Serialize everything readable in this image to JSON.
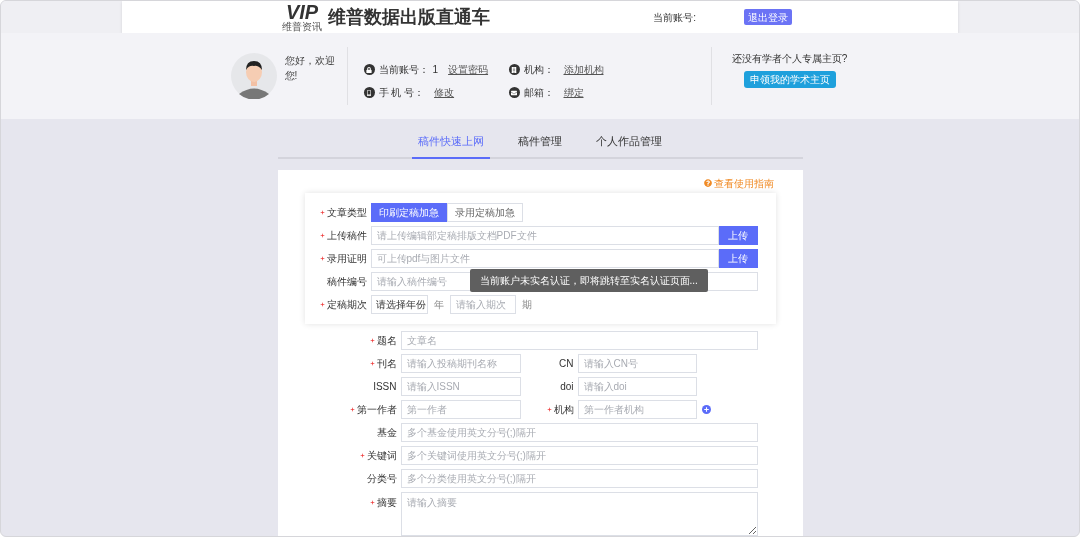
{
  "header": {
    "logo": {
      "mark": "VIP",
      "caption": "维普资讯"
    },
    "title": "维普数据出版直通车",
    "account_label": "当前账号:",
    "logout_button": "退出登录"
  },
  "profile": {
    "greeting": "您好，欢迎您!",
    "info": [
      {
        "kind": "lock",
        "label": "当前账号：",
        "value": "1",
        "link": "设置密码"
      },
      {
        "kind": "building",
        "label": "机构：",
        "link": "添加机构"
      },
      {
        "kind": "phone",
        "label": "手 机 号：",
        "link": "修改"
      },
      {
        "kind": "mail",
        "label": "邮箱：",
        "link": "绑定"
      }
    ],
    "promo_text": "还没有学者个人专属主页?",
    "promo_button": "申领我的学术主页"
  },
  "tabs": [
    {
      "label": "稿件快速上网",
      "selected": true
    },
    {
      "label": "稿件管理",
      "selected": false
    },
    {
      "label": "个人作品管理",
      "selected": false
    }
  ],
  "guide_link": "查看使用指南",
  "upload_form": [
    {
      "kind": "segmented",
      "label": "文章类型",
      "required": true,
      "options": [
        {
          "label": "印刷定稿加急",
          "selected": true
        },
        {
          "label": "录用定稿加急",
          "selected": false
        }
      ]
    },
    {
      "kind": "upload",
      "label": "上传稿件",
      "required": true,
      "placeholder": "请上传编辑部定稿排版文档PDF文件",
      "button": "上传"
    },
    {
      "kind": "upload",
      "label": "录用证明",
      "required": true,
      "placeholder": "可上传pdf与图片文件",
      "button": "上传"
    },
    {
      "kind": "text",
      "label": "稿件编号",
      "required": false,
      "placeholder": "请输入稿件编号"
    },
    {
      "kind": "period",
      "label": "定稿期次",
      "required": true,
      "select_placeholder": "请选择年份",
      "year_unit": "年",
      "placeholder": "请输入期次",
      "period_unit": "期"
    }
  ],
  "toast": "当前账户未实名认证，即将跳转至实名认证页面...",
  "details_form": [
    {
      "kind": "text",
      "label": "题名",
      "required": true,
      "placeholder": "文章名"
    },
    {
      "kind": "pair",
      "fields": [
        {
          "label": "刊名",
          "required": true,
          "placeholder": "请输入投稿期刊名称"
        },
        {
          "label": "CN",
          "required": false,
          "placeholder": "请输入CN号"
        }
      ],
      "add_button": false
    },
    {
      "kind": "pair",
      "fields": [
        {
          "label": "ISSN",
          "required": false,
          "placeholder": "请输入ISSN"
        },
        {
          "label": "doi",
          "required": false,
          "placeholder": "请输入doi"
        }
      ],
      "add_button": false
    },
    {
      "kind": "pair",
      "fields": [
        {
          "label": "第一作者",
          "required": true,
          "placeholder": "第一作者"
        },
        {
          "label": "机构",
          "required": true,
          "placeholder": "第一作者机构"
        }
      ],
      "add_button": true
    },
    {
      "kind": "text",
      "label": "基金",
      "required": false,
      "placeholder": "多个基金使用英文分号(;)隔开"
    },
    {
      "kind": "text",
      "label": "关键词",
      "required": true,
      "placeholder": "多个关键词使用英文分号(;)隔开"
    },
    {
      "kind": "text",
      "label": "分类号",
      "required": false,
      "placeholder": "多个分类使用英文分号(;)隔开"
    },
    {
      "kind": "textarea",
      "label": "摘要",
      "required": true,
      "placeholder": "请输入摘要"
    }
  ]
}
